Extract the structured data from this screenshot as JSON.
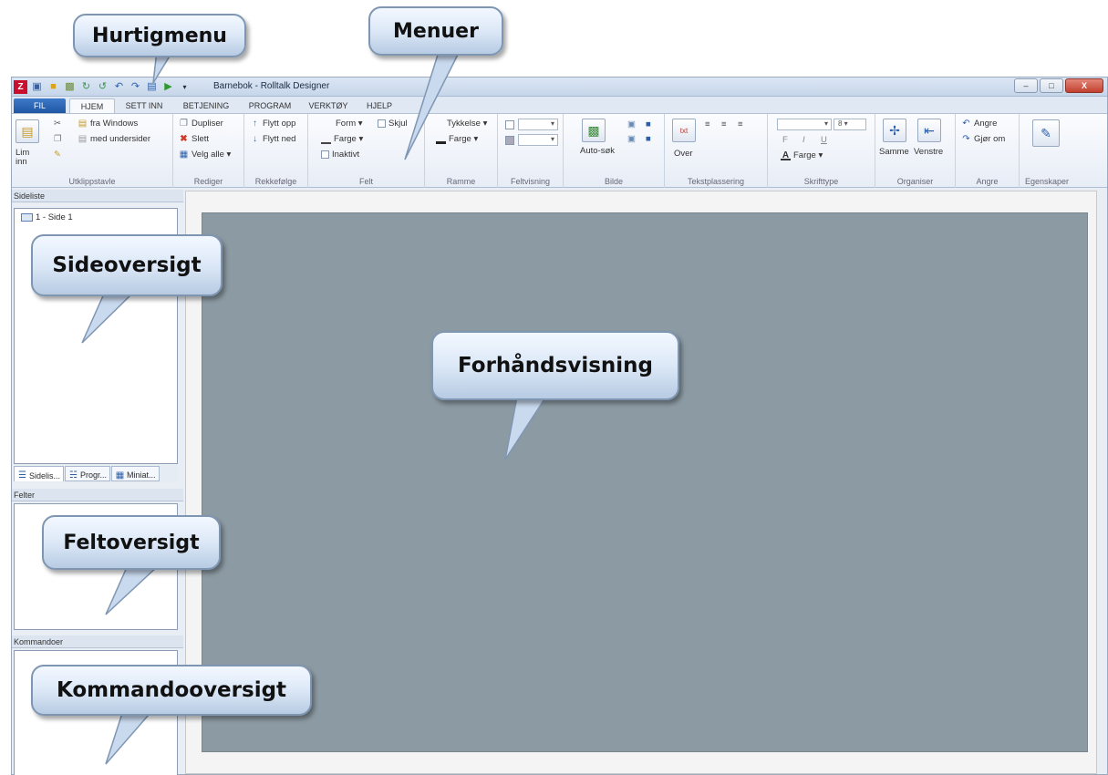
{
  "window": {
    "title": "Barnebok - Rolltalk Designer",
    "controls": {
      "minimize": "–",
      "maximize": "□",
      "close": "X"
    }
  },
  "qat_icons": [
    "app-logo-icon",
    "save-icon",
    "open-folder-icon",
    "print-icon",
    "refresh-icon",
    "sync-icon",
    "undo-icon",
    "redo-icon",
    "layout-icon",
    "play-icon",
    "customize-icon"
  ],
  "app_logo_glyph": "Z",
  "tabs": [
    "FIL",
    "HJEM",
    "SETT INN",
    "BETJENING",
    "PROGRAM",
    "VERKTØY",
    "HJELP"
  ],
  "active_tab": "HJEM",
  "ribbon": {
    "clipboard": {
      "paste": "Lim inn",
      "from_windows": "fra Windows",
      "with_subpages": "med undersider",
      "label": "Utklippstavle"
    },
    "edit": {
      "duplicate": "Dupliser",
      "delete": "Slett",
      "select_all": "Velg alle ▾",
      "label": "Rediger"
    },
    "order": {
      "move_up": "Flytt opp",
      "move_down": "Flytt ned",
      "label": "Rekkefølge"
    },
    "field": {
      "shape": "Form ▾",
      "hide": "Skjul",
      "color": "Farge ▾",
      "inactive": "Inaktivt",
      "label": "Felt"
    },
    "frame": {
      "thickness": "Tykkelse ▾",
      "color": "Farge ▾",
      "label": "Ramme"
    },
    "field_view": {
      "label": "Feltvisning"
    },
    "image": {
      "auto_search": "Auto-søk",
      "label": "Bilde"
    },
    "text_position": {
      "over": "Over",
      "label": "Tekstplassering"
    },
    "font": {
      "size": "8",
      "bold": "F",
      "italic": "I",
      "underline": "U",
      "color": "Farge ▾",
      "label": "Skrifttype"
    },
    "organize": {
      "same": "Samme",
      "left": "Venstre",
      "label": "Organiser"
    },
    "undo": {
      "undo": "Angre",
      "redo": "Gjør om",
      "label": "Angre"
    },
    "properties": {
      "label": "Egenskaper"
    }
  },
  "panels": {
    "page_list": {
      "header": "Sideliste",
      "items": [
        "1 - Side 1"
      ]
    },
    "panel_tabs": [
      "Sidelis...",
      "Progr...",
      "Miniat..."
    ],
    "fields": {
      "header": "Felter"
    },
    "commands": {
      "header": "Kommandoer"
    }
  },
  "callouts": {
    "quick_menu": "Hurtigmenu",
    "menus": "Menuer",
    "page_overview": "Sideoversigt",
    "preview": "Forhåndsvisning",
    "field_overview": "Feltoversigt",
    "command_overview": "Kommandooversigt"
  },
  "colors": {
    "preview_bg": "#8c9aa3",
    "accent_blue": "#1f56a4",
    "logo_red": "#c8102e"
  }
}
